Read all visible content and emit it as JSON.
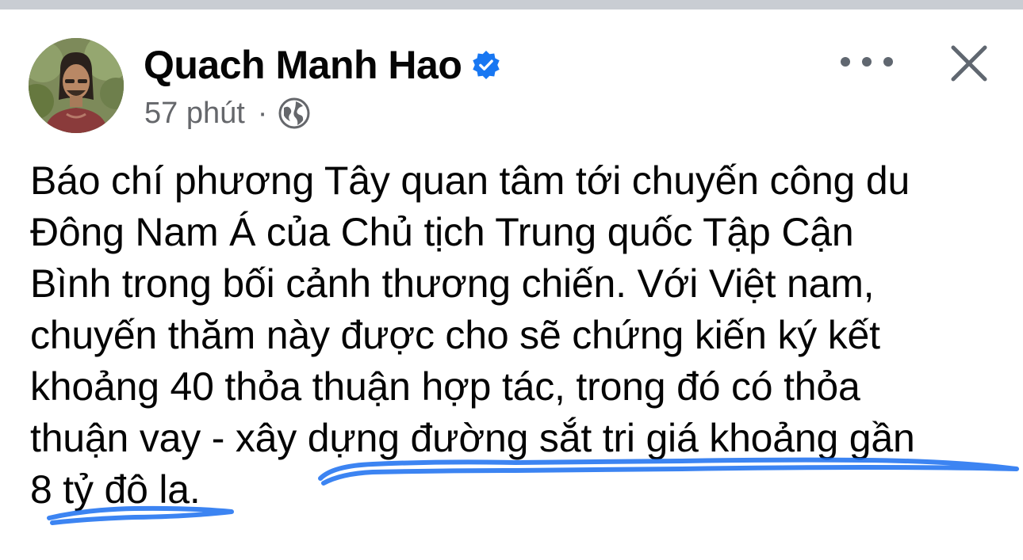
{
  "post": {
    "author": "Quach Manh Hao",
    "verified": true,
    "time": "57 phút",
    "separator": "·",
    "lines": [
      "Báo chí phương Tây quan tâm tới chuyến công du",
      "Đông Nam Á của Chủ tịch Trung quốc Tập Cận",
      "Bình trong bối cảnh thương chiến. Với Việt nam,",
      "chuyến thăm này được cho sẽ chứng kiến ký kết",
      "khoảng 40 thỏa thuận hợp tác, trong đó có thỏa",
      "thuận vay - xây dựng đường sắt tri giá khoảng gần",
      "8 tỷ đô la."
    ]
  },
  "icons": {
    "verified": "verified-badge-icon",
    "audience": "globe-icon",
    "more": "more-options-icon",
    "close": "close-icon"
  },
  "colors": {
    "verified_blue": "#1877f2",
    "secondary_text": "#65676b",
    "highlight_scribble": "#1a6ef0"
  }
}
